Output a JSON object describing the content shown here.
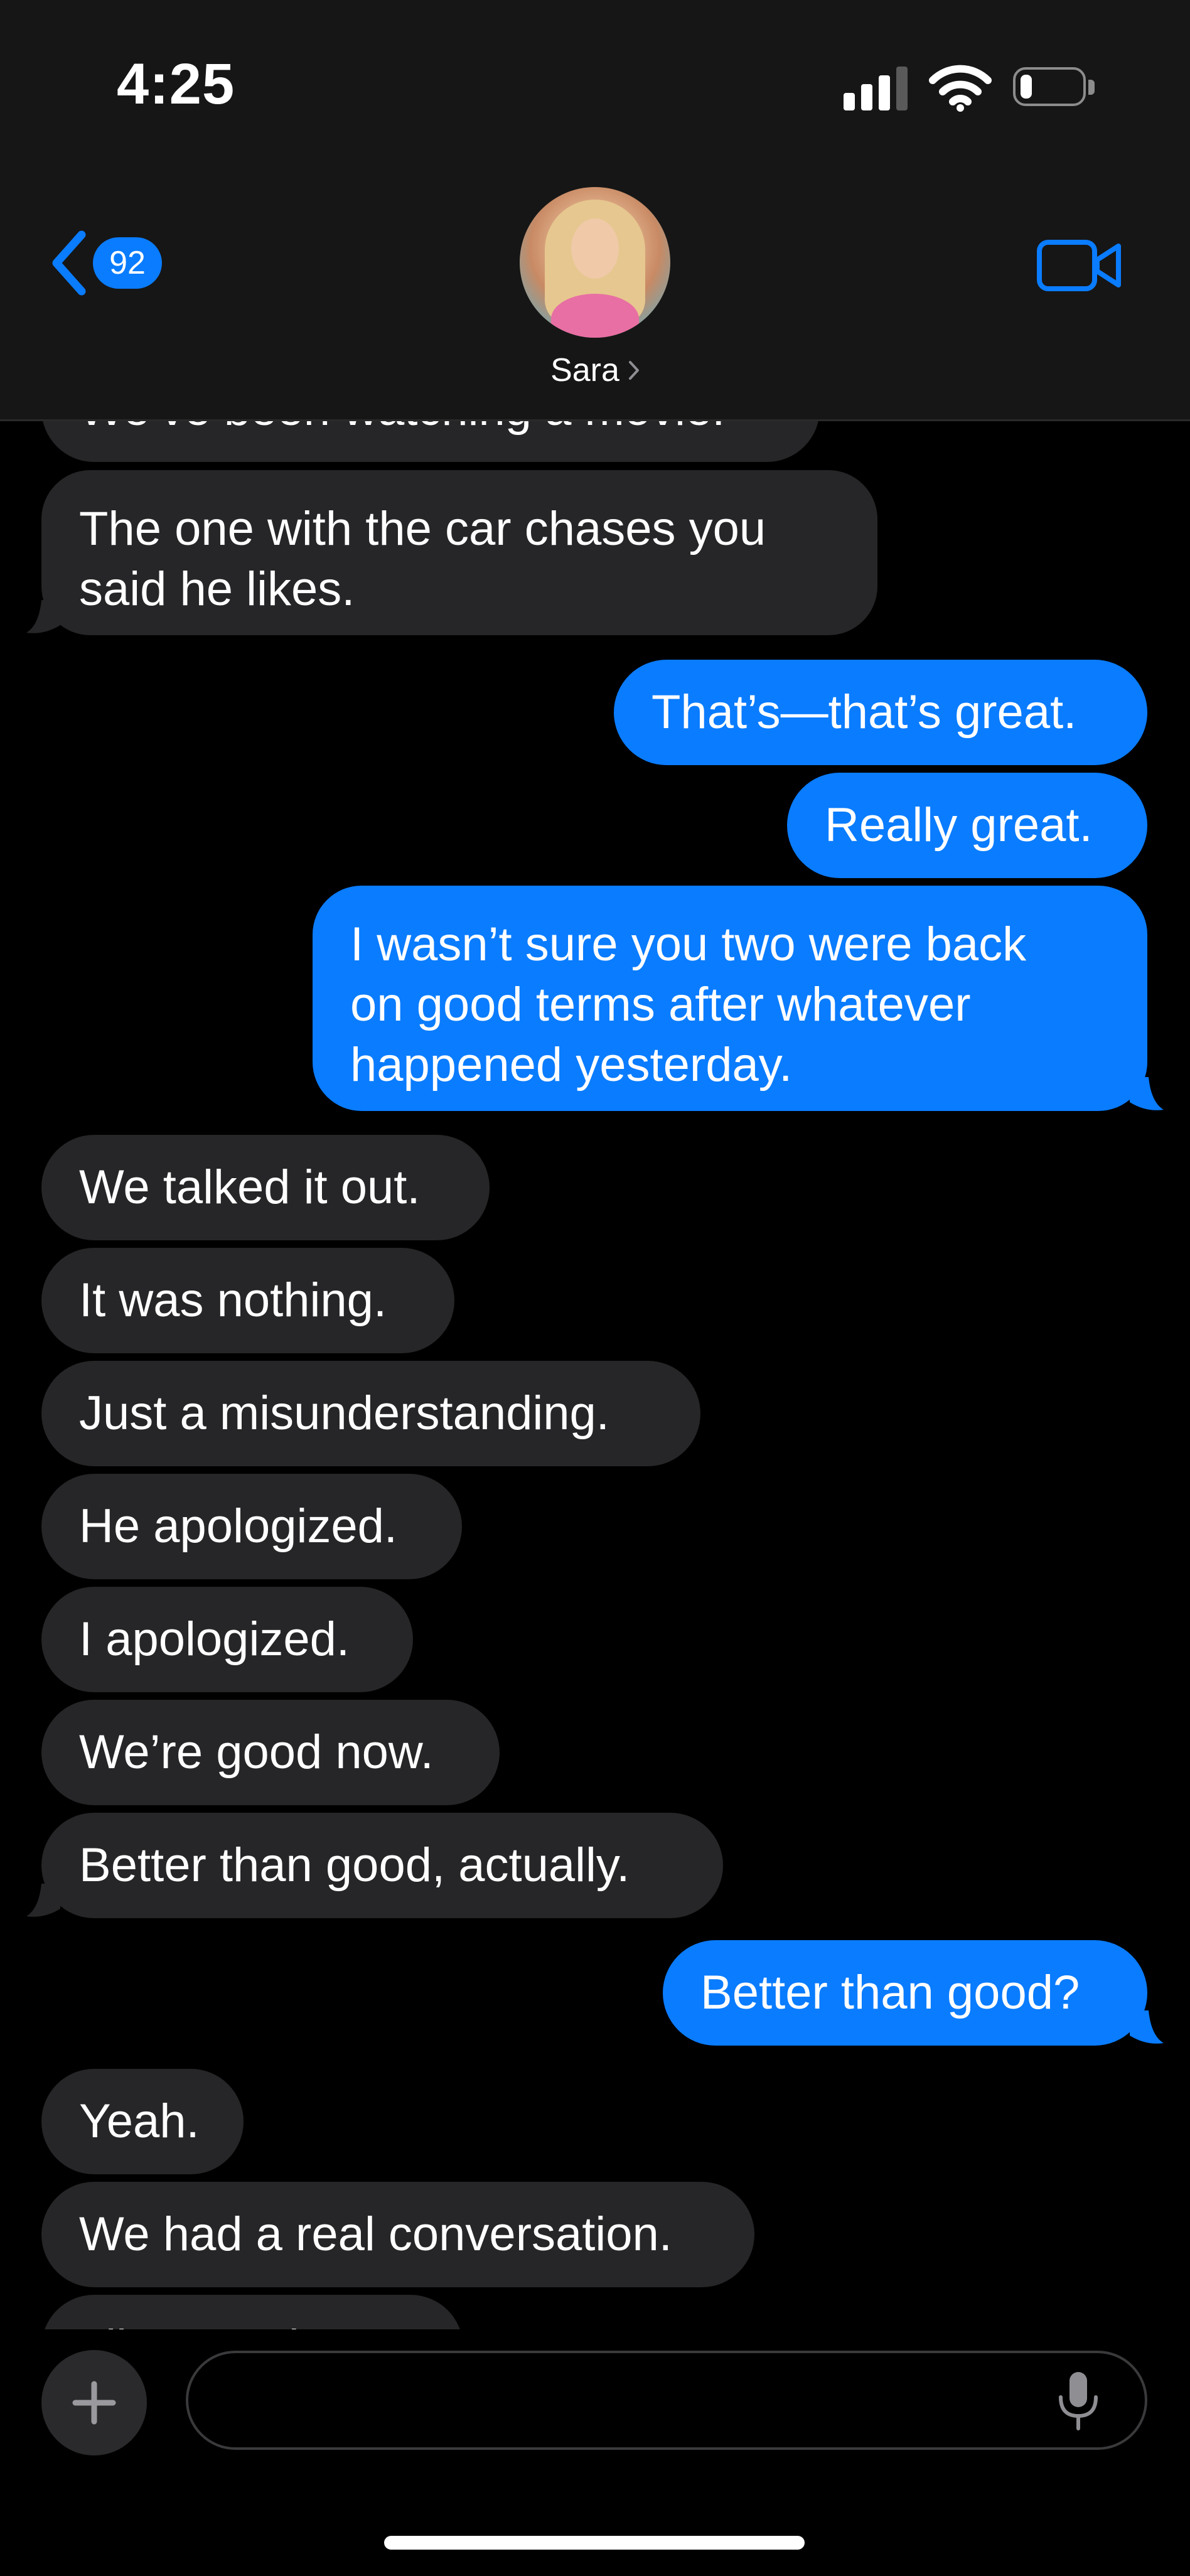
{
  "status_bar": {
    "time": "4:25",
    "battery_level": 0.2
  },
  "header": {
    "unread_count": "92",
    "contact_name": "Sara"
  },
  "messages": [
    {
      "side": "received",
      "text": "We’ve been watching a movie.",
      "partial": true
    },
    {
      "side": "received",
      "lines": [
        "The one with the car chases you",
        "said he likes."
      ],
      "tail": true
    },
    {
      "side": "sent",
      "text": "That’s—that’s great."
    },
    {
      "side": "sent",
      "text": "Really great."
    },
    {
      "side": "sent",
      "lines": [
        "I wasn’t sure you two were back",
        "on good terms after whatever",
        "happened yesterday."
      ],
      "tail": true
    },
    {
      "side": "received",
      "text": "We talked it out."
    },
    {
      "side": "received",
      "text": "It was nothing."
    },
    {
      "side": "received",
      "text": "Just a misunderstanding."
    },
    {
      "side": "received",
      "text": "He apologized."
    },
    {
      "side": "received",
      "text": "I apologized."
    },
    {
      "side": "received",
      "text": "We’re good now."
    },
    {
      "side": "received",
      "text": "Better than good, actually.",
      "tail": true
    },
    {
      "side": "sent",
      "text": "Better than good?",
      "tail": true
    },
    {
      "side": "received",
      "text": "Yeah."
    },
    {
      "side": "received",
      "text": "We had a real conversation."
    },
    {
      "side": "received",
      "text": "Like an adu",
      "partial": true
    }
  ],
  "input": {
    "value": "",
    "placeholder": ""
  },
  "colors": {
    "sent_bubble": "#0a7cff",
    "received_bubble": "#262628",
    "header_bg": "#161616",
    "accent": "#0a7cff"
  },
  "icons": [
    "back-chevron-icon",
    "video-camera-icon",
    "plus-icon",
    "microphone-icon",
    "signal-icon",
    "wifi-icon",
    "battery-icon",
    "chevron-right-icon"
  ]
}
